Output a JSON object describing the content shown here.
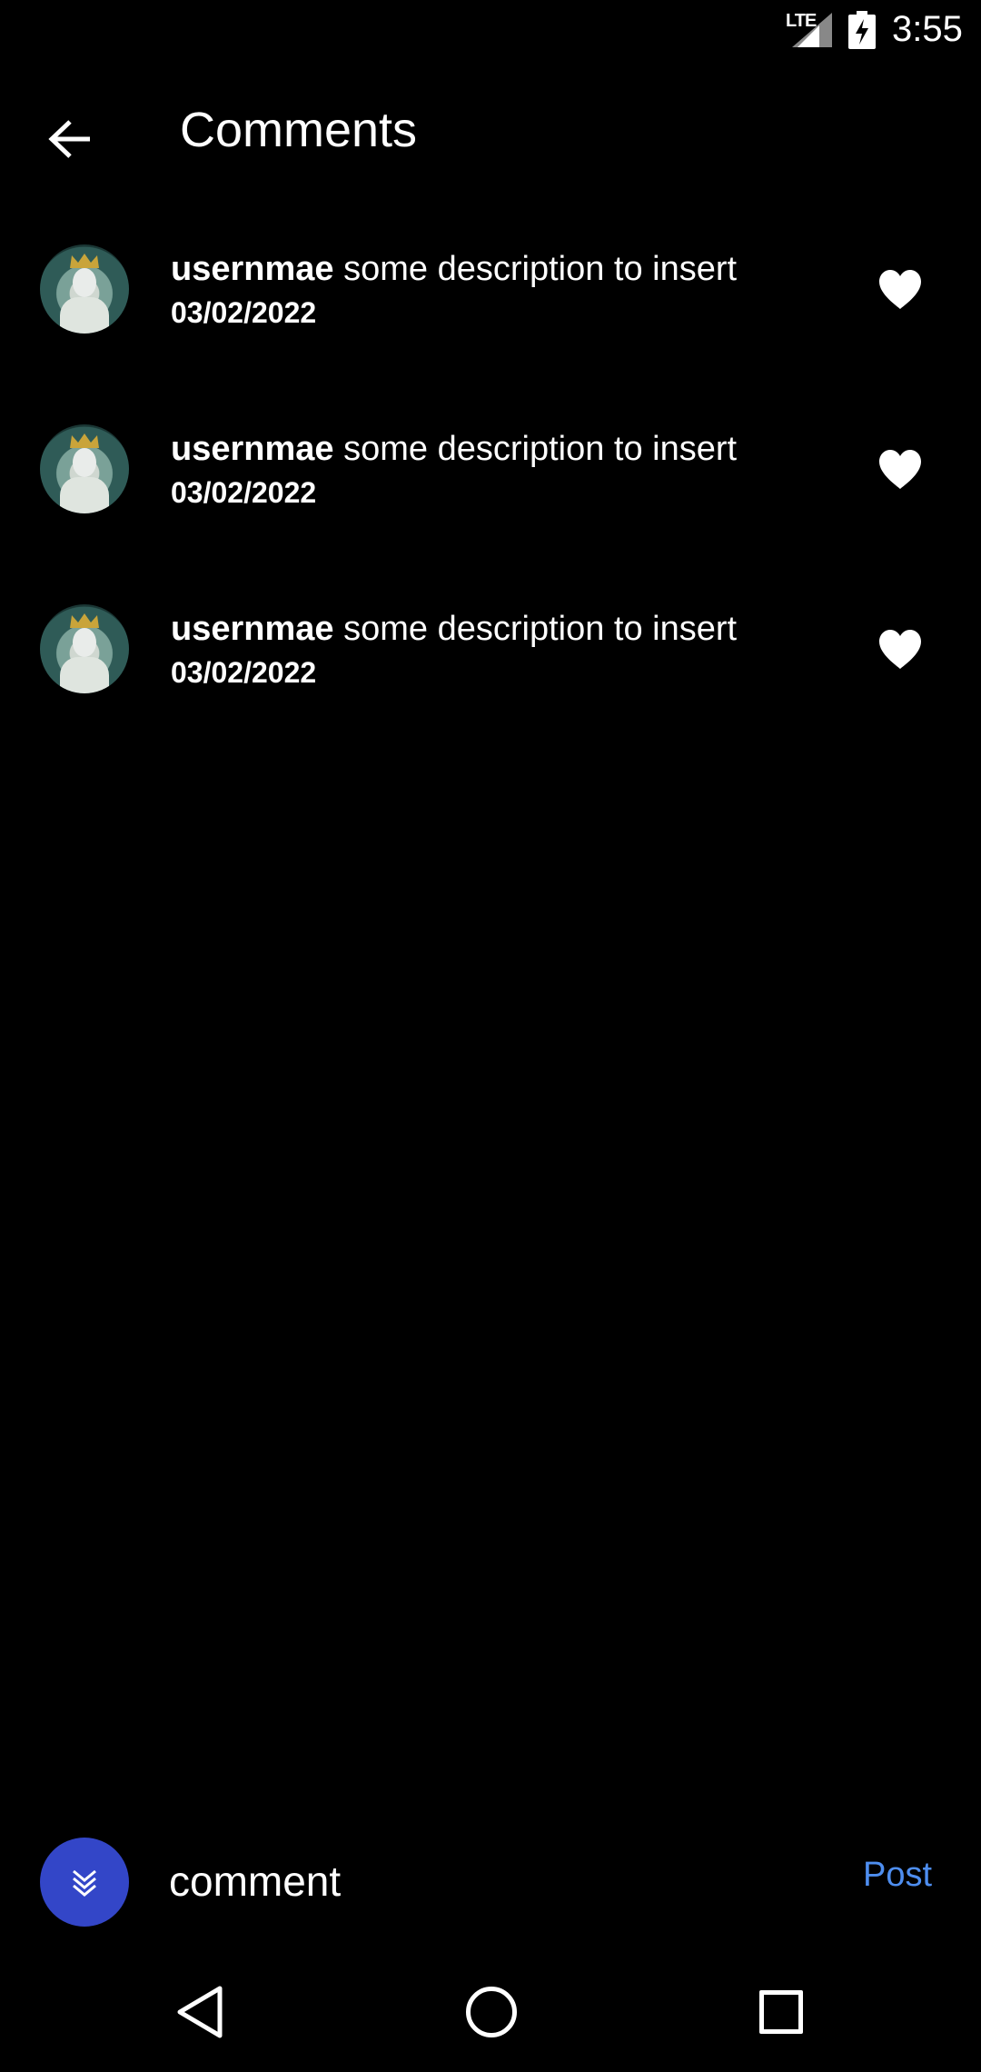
{
  "status_bar": {
    "network": "LTE",
    "time": "3:55"
  },
  "app_bar": {
    "title": "Comments"
  },
  "comments": [
    {
      "username": "usernmae",
      "text": "some description to insert",
      "date": "03/02/2022"
    },
    {
      "username": "usernmae",
      "text": "some description to insert",
      "date": "03/02/2022"
    },
    {
      "username": "usernmae",
      "text": "some description to insert",
      "date": "03/02/2022"
    }
  ],
  "composer": {
    "value": "comment",
    "post_label": "Post"
  },
  "icons": {
    "back": "arrow-left-icon",
    "like": "heart-icon",
    "composer_avatar": "chevrons-down-icon",
    "nav_back": "triangle-back-icon",
    "nav_home": "circle-home-icon",
    "nav_recents": "square-recents-icon"
  },
  "colors": {
    "background": "#000000",
    "accent": "#4e8ef0",
    "composer_avatar_bg": "#3346c8"
  }
}
